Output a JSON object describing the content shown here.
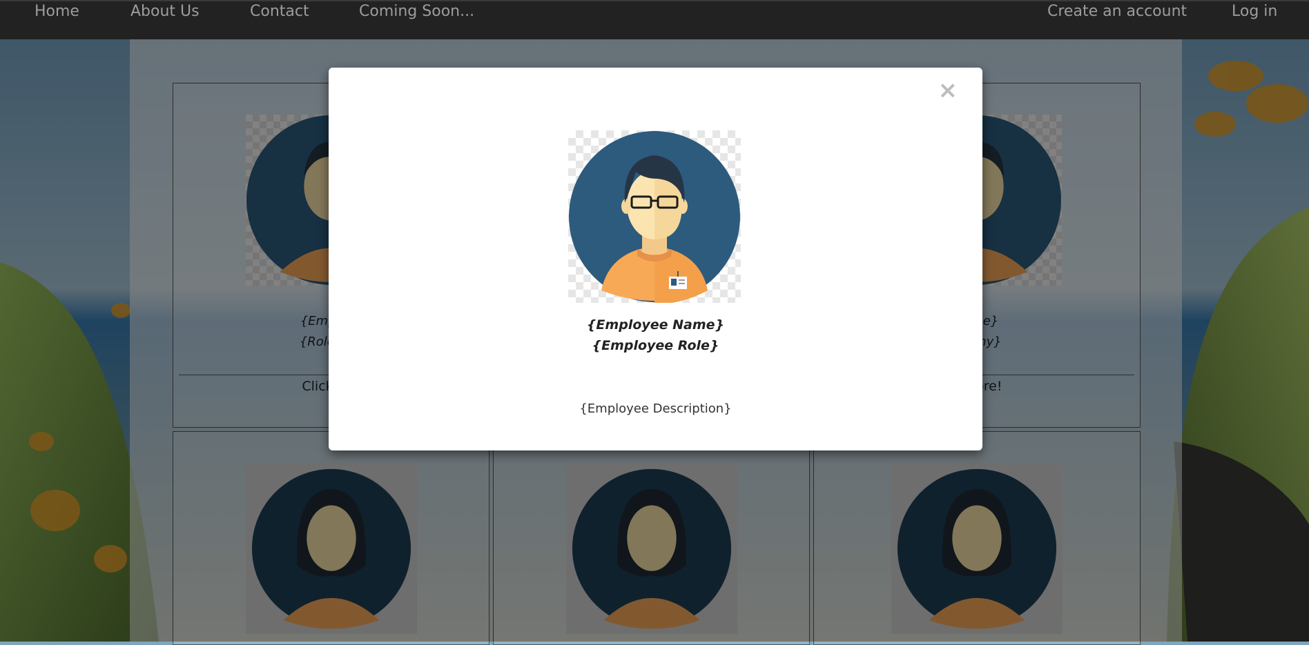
{
  "navbar": {
    "left_links": [
      "Home",
      "About Us",
      "Contact",
      "Coming Soon..."
    ],
    "right_links": [
      "Create an account",
      "Log in"
    ]
  },
  "cards": {
    "top_row": [
      {
        "name_fragment": "{Employe",
        "role_fragment": "{Role in C",
        "link_fragment": "Click to r"
      },
      {
        "name_fragment": " Name}",
        "role_fragment": "mpany}",
        "link_fragment": "d more!"
      }
    ]
  },
  "modal": {
    "close": "×",
    "name": "{Employee Name}",
    "role": "{Employee Role}",
    "description": "{Employee Description}",
    "avatar": "male-employee-avatar-icon"
  },
  "colors": {
    "navbar_bg": "#222222",
    "nav_link": "#9d9d9d",
    "avatar_circle": "#2d5b7d",
    "shirt": "#f5a85a"
  }
}
